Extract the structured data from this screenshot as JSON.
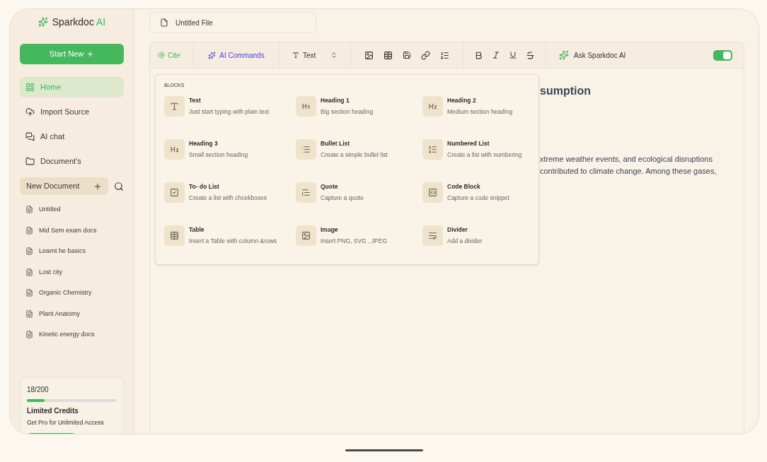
{
  "app": {
    "name": "Sparkdoc",
    "name_accent": "AI"
  },
  "sidebar": {
    "start_button": "Start New",
    "nav": [
      {
        "label": "Home",
        "selected": true
      },
      {
        "label": "Import Source",
        "selected": false
      },
      {
        "label": "AI chat",
        "selected": false
      },
      {
        "label": "Document's",
        "selected": false
      }
    ],
    "new_document": "New Document",
    "documents": [
      "Untitled",
      "Mid Sem exam docs",
      "Learnt he basics",
      "Lost city",
      "Organic Chemistry",
      "Plant Anatomy",
      "Kinetic energy docs"
    ],
    "credits": {
      "count": "18/200",
      "level": 0.2,
      "title": "Limited Credits",
      "subtitle": "Get Pro for Unlimited Access"
    }
  },
  "file_title": "Untitled File",
  "toolbar": {
    "cite": "Cite",
    "ai_commands": "AI Commands",
    "format": "Text",
    "ask": "Ask Sparkdoc AI",
    "toggle_on": true
  },
  "document": {
    "heading": "sumption",
    "lines": [
      "xtreme weather events, and ecological disruptions",
      "contributed to climate change. Among these gases,"
    ]
  },
  "blocks_menu": {
    "title": "BLOCKS",
    "items": [
      {
        "kind": "text",
        "title": "Text",
        "description": "Just start typing with plain text"
      },
      {
        "kind": "h1",
        "title": "Heading 1",
        "description": "Big section heading"
      },
      {
        "kind": "h2",
        "title": "Heading 2",
        "description": "Medium section heading"
      },
      {
        "kind": "h3",
        "title": "Heading 3",
        "description": "Small section heading"
      },
      {
        "kind": "bullet",
        "title": "Bullet List",
        "description": "Create a simple bullet list"
      },
      {
        "kind": "numbered",
        "title": "Numbered List",
        "description": "Create a list with numbering"
      },
      {
        "kind": "todo",
        "title": "To- do List",
        "description": "Create a list with chcekboxes"
      },
      {
        "kind": "quote",
        "title": "Quote",
        "description": "Capture a quote"
      },
      {
        "kind": "code",
        "title": "Code Block",
        "description": "Capture a code snippet"
      },
      {
        "kind": "table",
        "title": "Table",
        "description": "Insert a Table with column &rows"
      },
      {
        "kind": "image",
        "title": "Image",
        "description": "Insert PNG, SVG , JPEG"
      },
      {
        "kind": "divider",
        "title": "Divider",
        "description": "Add a divider"
      }
    ]
  }
}
